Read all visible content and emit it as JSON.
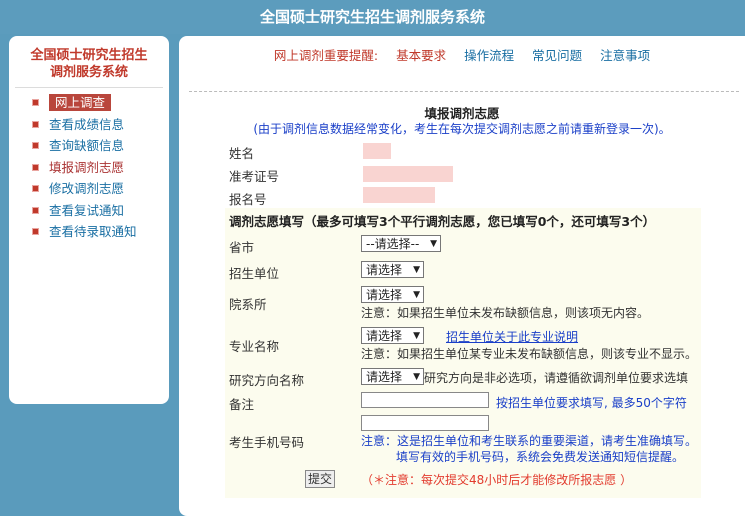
{
  "header": {
    "title": "全国硕士研究生招生调剂服务系统"
  },
  "sidebar": {
    "title_line1": "全国硕士研究生招生",
    "title_line2": "调剂服务系统",
    "items": [
      {
        "label": "网上调查"
      },
      {
        "label": "查看成绩信息"
      },
      {
        "label": "查询缺额信息"
      },
      {
        "label": "填报调剂志愿"
      },
      {
        "label": "修改调剂志愿"
      },
      {
        "label": "查看复试通知"
      },
      {
        "label": "查看待录取通知"
      }
    ]
  },
  "nav": {
    "warn": "网上调剂重要提醒:",
    "basic": "基本要求",
    "process": "操作流程",
    "faq": "常见问题",
    "notes": "注意事项"
  },
  "form": {
    "title": "填报调剂志愿",
    "subtitle": "(由于调剂信息数据经常变化，考生在每次提交调剂志愿之前请重新登录一次)。",
    "name_label": "姓名",
    "exam_id_label": "准考证号",
    "reg_id_label": "报名号",
    "panel_title": "调剂志愿填写（最多可填写3个平行调剂志愿，您已填写0个，还可填写3个）",
    "province_label": "省市",
    "province_value": "--请选择--",
    "unit_label": "招生单位",
    "unit_value": "请选择",
    "dept_label": "院系所",
    "dept_value": "请选择",
    "dept_note": "注意：如果招生单位未发布缺额信息，则该项无内容。",
    "major_label": "专业名称",
    "major_value": "请选择",
    "major_link": "招生单位关于此专业说明",
    "major_note": "注意：如果招生单位某专业未发布缺额信息，则该专业不显示。",
    "direction_label": "研究方向名称",
    "direction_value": "请选择",
    "direction_note": "研究方向是非必选项，请遵循欲调剂单位要求选填",
    "remark_label": "备注",
    "remark_value": "",
    "remark_hint": "按招生单位要求填写, 最多50个字符",
    "phone_label": "考生手机号码",
    "phone_value": "",
    "phone_note1": "注意：这是招生单位和考生联系的重要渠道，请考生准确填写。",
    "phone_note2": "填写有效的手机号码，系统会免费发送通知短信提醒。",
    "submit_label": "提交",
    "warn": "（＊注意：每次提交48小时后才能修改所报志愿 ）"
  }
}
